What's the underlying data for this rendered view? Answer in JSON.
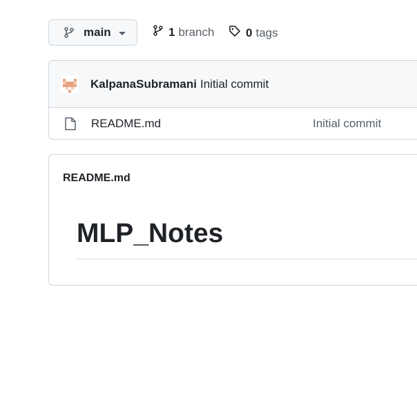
{
  "branch_selector": {
    "name": "main",
    "icon": "git-branch-icon"
  },
  "branches": {
    "count": "1",
    "label": "branch",
    "icon": "git-branch-icon"
  },
  "tags": {
    "count": "0",
    "label": "tags",
    "icon": "tag-icon"
  },
  "latest_commit": {
    "author": "KalpanaSubramani",
    "message": "Initial commit",
    "avatar_colors": [
      "#e7a47f",
      "#f3d2bf"
    ]
  },
  "files": [
    {
      "name": "README.md",
      "commit_message": "Initial commit",
      "icon": "file-icon"
    }
  ],
  "readme": {
    "title": "README.md",
    "heading": "MLP_Notes"
  },
  "colors": {
    "border": "#d0d7de",
    "header_bg": "#f6f8fa",
    "text": "#1f2328",
    "muted": "#57606a"
  }
}
